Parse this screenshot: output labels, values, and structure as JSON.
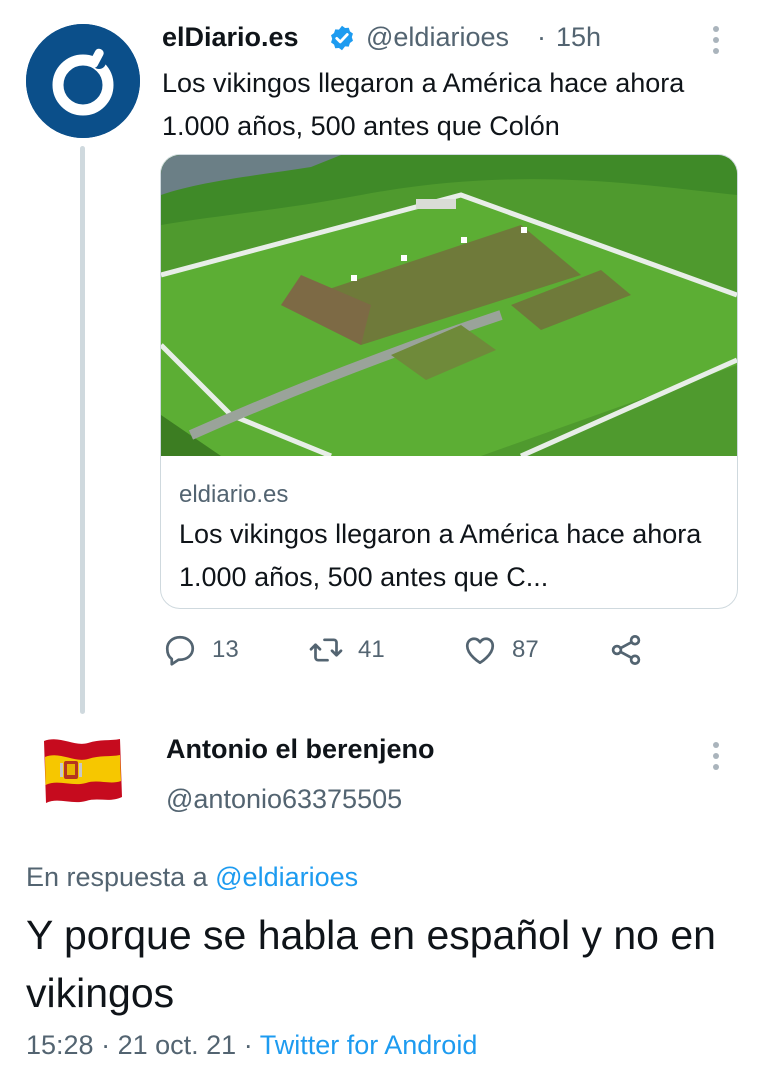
{
  "tweet": {
    "author_name": "elDiario.es",
    "author_handle": "@eldiarioes",
    "separator": "·",
    "time": "15h",
    "text": "Los vikingos llegaron a América hace ahora 1.000 años, 500 antes que Colón",
    "card": {
      "domain": "eldiario.es",
      "title": "Los vikingos llegaron a América hace ahora 1.000 años, 500 antes que C..."
    },
    "actions": {
      "replies": "13",
      "retweets": "41",
      "likes": "87"
    }
  },
  "reply": {
    "author_name": "Antonio el berenjeno",
    "author_handle": "@antonio63375505",
    "reply_prefix": "En respuesta a",
    "reply_to": "@eldiarioes",
    "text": "Y porque se habla en español y no en vikingos",
    "time": "15:28",
    "separator1": "·",
    "date": "21 oct. 21",
    "separator2": "·",
    "source": "Twitter for Android"
  },
  "colors": {
    "accent": "#1d9bf0",
    "secondary_text": "#536471",
    "brand_blue": "#0b4f8a"
  },
  "icons": {
    "verified": "verified-badge-icon",
    "more": "more-vertical-icon",
    "reply": "reply-icon",
    "retweet": "retweet-icon",
    "like": "heart-icon",
    "share": "share-icon"
  }
}
